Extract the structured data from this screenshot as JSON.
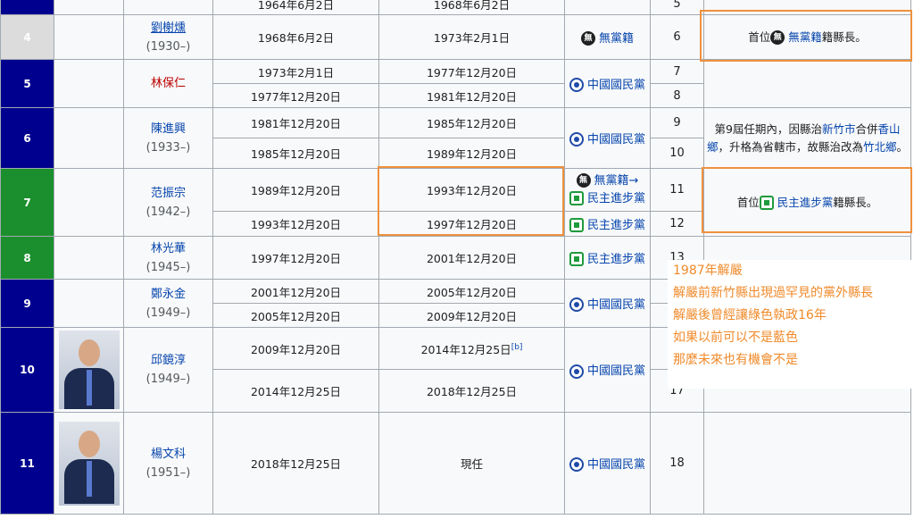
{
  "rows": {
    "partial": {
      "date_start": "1964年6月2日",
      "date_end": "1968年6月2日",
      "term": "5"
    },
    "r4": {
      "num": "4",
      "name": "劉榭燻",
      "years": "(1930–)",
      "d1s": "1968年6月2日",
      "d1e": "1973年2月1日",
      "party": "無黨籍",
      "term": "6",
      "note_pre": "首位",
      "note_link": "無黨籍",
      "note_post": "籍縣長。"
    },
    "r5": {
      "num": "5",
      "name": "林保仁",
      "d1s": "1973年2月1日",
      "d1e": "1977年12月20日",
      "d2s": "1977年12月20日",
      "d2e": "1981年12月20日",
      "party": "中國國民黨",
      "t1": "7",
      "t2": "8"
    },
    "r6": {
      "num": "6",
      "name": "陳進興",
      "years": "(1933–)",
      "d1s": "1981年12月20日",
      "d1e": "1985年12月20日",
      "d2s": "1985年12月20日",
      "d2e": "1989年12月20日",
      "party": "中國國民黨",
      "t1": "9",
      "t2": "10",
      "note_a": "第9屆任期內，因縣治",
      "note_l1": "新竹市",
      "note_b": "合併",
      "note_l2": "香山鄉",
      "note_c": "，升格為省轄市，故縣治改為",
      "note_l3": "竹北鄉",
      "note_d": "。"
    },
    "r7": {
      "num": "7",
      "name": "范振宗",
      "years": "(1942–)",
      "d1s": "1989年12月20日",
      "d1e": "1993年12月20日",
      "d2s": "1993年12月20日",
      "d2e": "1997年12月20日",
      "party1": "無黨籍→",
      "party2": "民主進步黨",
      "party3": "民主進步黨",
      "t1": "11",
      "t2": "12",
      "note_pre": "首位",
      "note_link": "民主進步黨",
      "note_post": "籍縣長。"
    },
    "r8": {
      "num": "8",
      "name": "林光華",
      "years": "(1945–)",
      "d1s": "1997年12月20日",
      "d1e": "2001年12月20日",
      "party": "民主進步黨",
      "term": "13"
    },
    "r9": {
      "num": "9",
      "name": "鄭永金",
      "years": "(1949–)",
      "d1s": "2001年12月20日",
      "d1e": "2005年12月20日",
      "d2s": "2005年12月20日",
      "d2e": "2009年12月20日",
      "party": "中國國民黨"
    },
    "r10": {
      "num": "10",
      "name": "邱鏡淳",
      "years": "(1949–)",
      "d1s": "2009年12月20日",
      "d1e": "2014年12月25日",
      "ref": "[b]",
      "d2s": "2014年12月25日",
      "d2e": "2018年12月25日",
      "party": "中國國民黨",
      "t2": "17"
    },
    "r11": {
      "num": "11",
      "name": "楊文科",
      "years": "(1951–)",
      "d1s": "2018年12月25日",
      "d1e": "現任",
      "party": "中國國民黨",
      "term": "18"
    }
  },
  "overlay": [
    "1987年解嚴",
    "解嚴前新竹縣出現過罕見的黨外縣長",
    "解嚴後曾經讓綠色執政16年",
    "如果以前可以不是藍色",
    "那麼未來也有機會不是"
  ],
  "icons": {
    "no_party": "無",
    "kmt": "kmt-emblem-icon",
    "dpp": "dpp-emblem-icon"
  },
  "colors": {
    "kmt_row": "#00008f",
    "dpp_row": "#1b8f2d",
    "independent_row": "#dcdcdc",
    "highlight": "#f0913e",
    "overlay_text": "#f08a2a"
  }
}
